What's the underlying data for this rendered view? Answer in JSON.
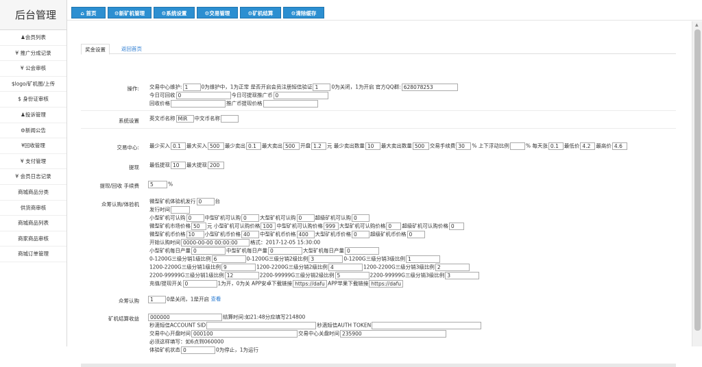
{
  "logo": "后台管理",
  "sidebar": {
    "items": [
      "会员列表",
      "¥ 推广分成记录",
      "¥ 公会审核",
      "$logo/矿机图/上传",
      "$ 身份证审核",
      "投诉管理",
      "新闻公告",
      "¥回收管理",
      "¥ 支付管理",
      "¥ 会员日志记录",
      "商城商品分类",
      "供货商审核",
      "商城商品列表",
      "商家商品审核",
      "商城订单管理"
    ]
  },
  "topnav": {
    "tabs": [
      "首页",
      "新矿机管理",
      "系统设置",
      "交易管理",
      "矿机结算",
      "清除缓存"
    ]
  },
  "content": {
    "tabs": {
      "active": "奖金设置",
      "link": "返回首页"
    },
    "op": {
      "label": "操作:",
      "t1": "交易中心维护:",
      "v1": "1",
      "t2": "0为维护中，1为正常 是否开启会员注册短信验证",
      "v2": "1",
      "t3": "0为关闭，1为开启 官方QQ群:",
      "v3": "628078253",
      "t4": "今日可回收",
      "v4": "0",
      "t5": "今日可提现推广币",
      "v5": "0",
      "t6": "回收价格",
      "v6": "",
      "t7": "推广币提现价格",
      "v7": ""
    },
    "sys": {
      "label": "系统设置",
      "t1": "英文币名称",
      "v1": "MIR",
      "t2": "中文币名称",
      "v2": ""
    },
    "trade": {
      "label": "交易中心:",
      "t1": "最少买入",
      "v1": "0.1",
      "t2": "最大买入",
      "v2": "500",
      "t3": "最少卖出",
      "v3": "0.1",
      "t4": "最大卖出",
      "v4": "500",
      "t5": "开盘",
      "v5": "1.2",
      "t6": "元 最少卖出数量",
      "v6": "10",
      "t7": "最大卖出数量",
      "v7": "500",
      "t8": "交易手续费",
      "v8": "30",
      "t9": "% 上下浮动比例",
      "v9": "",
      "t10": "% 每天涨",
      "v10": "0.1",
      "t11": "最低价",
      "v11": "4.2",
      "t12": "最高价",
      "v12": "4.6"
    },
    "withdraw": {
      "label": "提现",
      "t1": "最低提现",
      "v1": "10",
      "t2": "最大提现",
      "v2": "200"
    },
    "fee": {
      "label": "提现/回收 手续费",
      "v1": "5",
      "t1": "%"
    },
    "crowd": {
      "label": "众筹认购/体验机",
      "l1a": "微型矿机体验机发行",
      "l1v": "0",
      "l1b": "台",
      "l2a": "发行时间",
      "l2v": "",
      "l3a": "小型矿机可认购",
      "l3v1": "0",
      "l3b": "中型矿机可认购",
      "l3v2": "0",
      "l3c": "大型矿机可认购",
      "l3v3": "0",
      "l3d": "超级矿机可认购",
      "l3v4": "0",
      "l4a": "微型矿机市场价格",
      "l4v1": "50",
      "l4b": "元 小型矿机可认购价格",
      "l4v2": "100",
      "l4c": "中型矿机可认购价格",
      "l4v3": "999",
      "l4d": "大型矿机可认购价格",
      "l4v4": "0",
      "l4e": "超级矿机可认购价格",
      "l4v5": "0",
      "l5a": "微型矿机币价格",
      "l5v1": "10",
      "l5b": "小型矿机币价格",
      "l5v2": "40",
      "l5c": "中型矿机币价格",
      "l5v3": "400",
      "l5d": "大型矿机币价格",
      "l5v4": "0",
      "l5e": "超级矿机币价格",
      "l5v5": "0",
      "l6a": "开始认购时间",
      "l6v": "0000-00-00 00:00:00",
      "l6b": "格式：2017-12-05 15:30:00",
      "l7a": "小型矿机每日产量",
      "l7v1": "0",
      "l7b": "中型矿机每日产量",
      "l7v2": "0",
      "l7c": "大型矿机每日产量",
      "l7v3": "0",
      "l8a": "0-1200G三级分销1级比例",
      "l8v1": "6",
      "l8b": "0-1200G三级分销2级比例",
      "l8v2": "3",
      "l8c": "0-1200G三级分销3级比例",
      "l8v3": "1",
      "l9a": "1200-2200G三级分销1级比例",
      "l9v1": "9",
      "l9b": "1200-2200G三级分销2级比例",
      "l9v2": "4",
      "l9c": "1200-2200G三级分销3级比例",
      "l9v3": "2",
      "l10a": "2200-99999G三级分销1级比例",
      "l10v1": "12",
      "l10b": "2200-99999G三级分销2级比例",
      "l10v2": "5",
      "l10c": "2200-99999G三级分销3级比例",
      "l10v3": "3",
      "l11a": "充值/提现开关",
      "l11v1": "0",
      "l11b": "1为开，0为关 APP安卓下载链接",
      "l11v2": "https://dafuv",
      "l11c": "APP苹果下载链接",
      "l11v3": "https://dafuv"
    },
    "sub": {
      "label": "众筹认购",
      "v1": "1",
      "t1": "0是关闭，1是开启",
      "link": "查看"
    },
    "settle": {
      "label": "矿机结算收益",
      "v1": "000000",
      "t1": "结算时间:如21:48分应填写214800",
      "t2": "秒滴短信ACCOUNT SID",
      "v2": "",
      "t3": "秒滴短信AUTH TOKEN",
      "v3": "",
      "t4": "交易中心开盘时间",
      "v4": "000100",
      "t5": "交易中心关盘时间",
      "v5": "235900",
      "t6": "必须这样填写：如6点到060000",
      "t7": "体验矿机状态",
      "v7": "0",
      "t8": "0为停止，1为运行"
    }
  }
}
